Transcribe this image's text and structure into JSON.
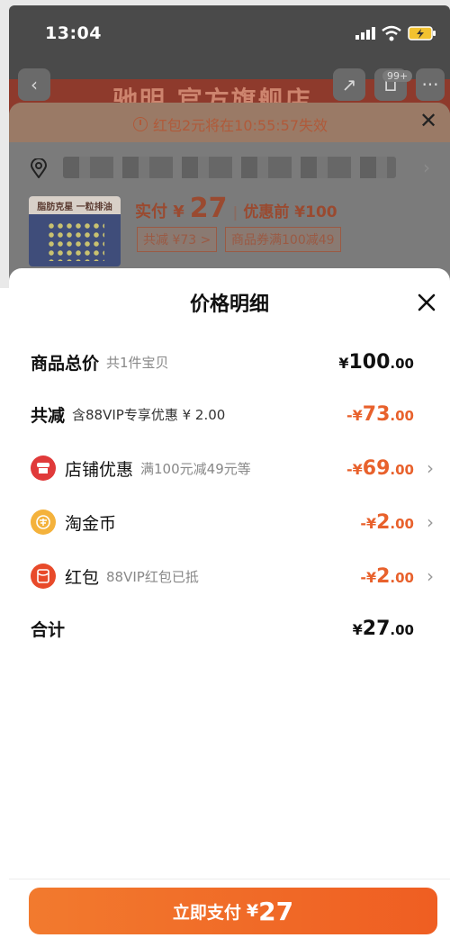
{
  "status_bar": {
    "time": "13:04"
  },
  "background": {
    "banner_text": "驰明 官方旗舰店",
    "cart_badge": "99+",
    "expire_notice": "红包2元将在10:55:57失效",
    "product_thumb_label": "脂肪克星 一粒排油",
    "pay_label": "实付 ¥",
    "pay_amount": "27",
    "pre_price": "优惠前 ¥100",
    "discount_tag": "共减 ¥73 >",
    "coupon_tag": "商品券满100减49"
  },
  "sheet": {
    "title": "价格明细",
    "rows": [
      {
        "label": "商品总价",
        "sub": "共1件宝贝",
        "sym": "¥",
        "int": "100",
        "dec": ".00"
      },
      {
        "label": "共减",
        "sub": "含88VIP专享优惠 ¥ 2.00",
        "sym": "-¥",
        "int": "73",
        "dec": ".00"
      },
      {
        "label": "店铺优惠",
        "sub": "满100元减49元等",
        "sym": "-¥",
        "int": "69",
        "dec": ".00",
        "icon": "shop-icon"
      },
      {
        "label": "淘金币",
        "sub": "",
        "sym": "-¥",
        "int": "2",
        "dec": ".00",
        "icon": "coin-icon"
      },
      {
        "label": "红包",
        "sub": "88VIP红包已抵",
        "sym": "-¥",
        "int": "2",
        "dec": ".00",
        "icon": "hongbao-icon"
      },
      {
        "label": "合计",
        "sub": "",
        "sym": "¥",
        "int": "27",
        "dec": ".00"
      }
    ],
    "pay_button": {
      "label": "立即支付",
      "sym": "¥",
      "amount": "27"
    }
  },
  "colors": {
    "accent": "#ef5e22",
    "discount_red": "#e8612c"
  }
}
